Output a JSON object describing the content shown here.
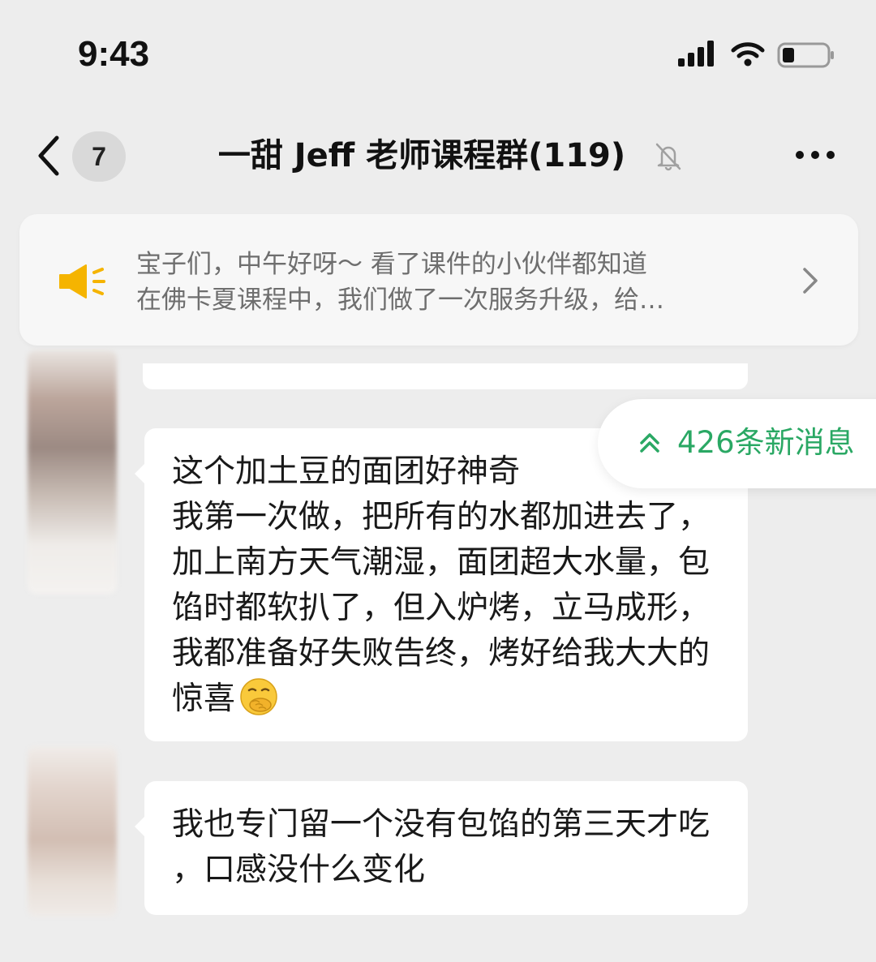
{
  "status_bar": {
    "time": "9:43"
  },
  "nav": {
    "unread_count": "7",
    "title": "一甜 Jeff 老师课程群(119)",
    "icons": [
      "chevron-left-icon",
      "bell-muted-icon",
      "more-dots-icon"
    ]
  },
  "announcement": {
    "line1": "宝子们，中午好呀～ 看了课件的小伙伴都知道",
    "line2": "在佛卡夏课程中，我们做了一次服务升级，给…",
    "icons": [
      "speaker-icon",
      "chevron-right-icon"
    ],
    "accent_color": "#f5b400"
  },
  "new_messages": {
    "label": "426条新消息",
    "icon": "double-chevron-up-icon",
    "color": "#2aa864"
  },
  "messages": [
    {
      "text": "这个加土豆的面团好神奇\n我第一次做，把所有的水都加进去了，加上南方天气潮湿，面团超大水量，包馅时都软扒了，但入炉烤，立马成形，我都准备好失败告终，烤好给我大大的惊喜",
      "emoji": "hand-over-mouth-emoji"
    },
    {
      "text": "我也专门留一个没有包馅的第三天才吃 ，口感没什么变化"
    }
  ]
}
